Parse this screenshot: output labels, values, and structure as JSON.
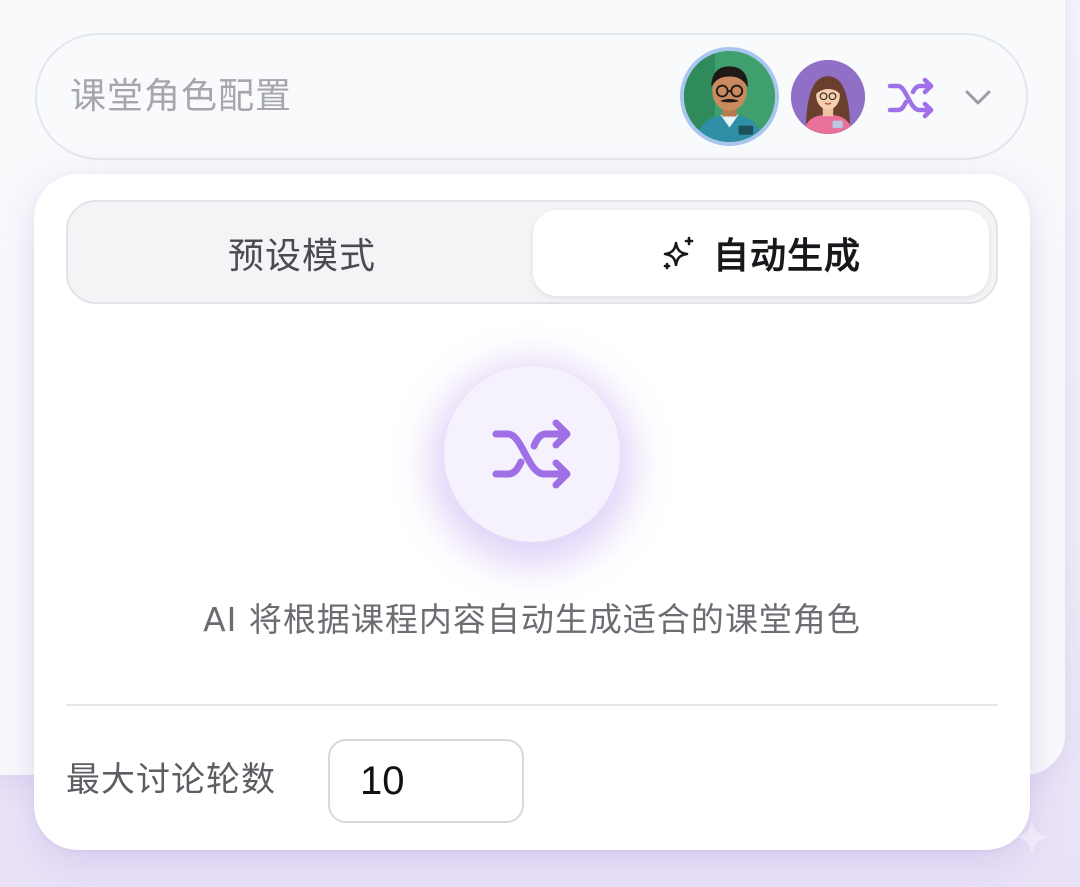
{
  "selector": {
    "label": "课堂角色配置",
    "avatars": [
      {
        "name": "teacher-avatar",
        "bg": "#3a9d6b"
      },
      {
        "name": "student-avatar",
        "bg": "#8f6fc4"
      }
    ],
    "shuffle_icon": "shuffle-icon",
    "chevron_icon": "chevron-down-icon"
  },
  "panel": {
    "tabs": {
      "preset_label": "预设模式",
      "auto_label": "自动生成",
      "active": "auto"
    },
    "auto": {
      "icon": "shuffle-icon",
      "description": "AI 将根据课程内容自动生成适合的课堂角色"
    },
    "rounds": {
      "label": "最大讨论轮数",
      "value": "10"
    }
  },
  "colors": {
    "accent": "#9f6fe6",
    "muted_text": "#a5a7ad"
  }
}
